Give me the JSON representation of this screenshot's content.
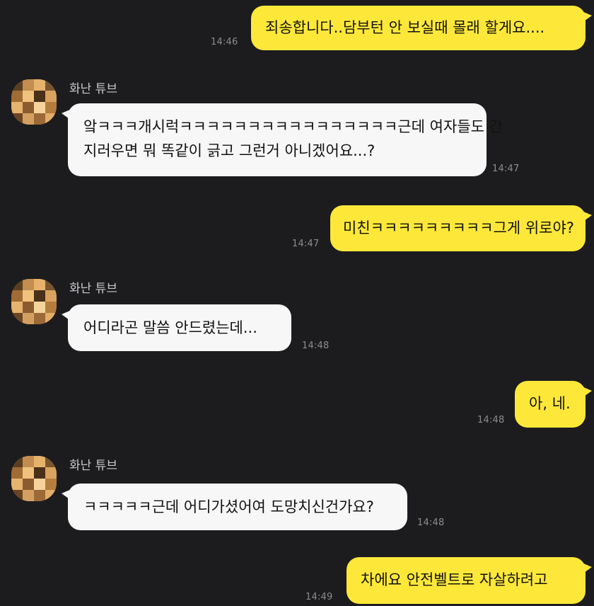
{
  "contact": {
    "name": "화난 튜브"
  },
  "messages": [
    {
      "side": "mine",
      "text": "죄송합니다..담부턴 안 보실때 몰래 할게요....",
      "time": "14:46"
    },
    {
      "side": "theirs",
      "line1": "앜ㅋㅋㅋ개시럭ㅋㅋㅋㅋㅋㅋㅋㅋㅋㅋㅋㅋㅋㅋㅋㅋ근데 여자들도 간",
      "line2": "지러우면 뭐 똑같이 긁고 그런거 아니겠어요...?",
      "time": "14:47"
    },
    {
      "side": "mine",
      "text": "미친ㅋㅋㅋㅋㅋㅋㅋㅋㅋ그게 위로야?",
      "time": "14:47"
    },
    {
      "side": "theirs",
      "text": "어디라곤 말씀 안드렸는데...",
      "time": "14:48"
    },
    {
      "side": "mine",
      "text": "아, 네.",
      "time": "14:48"
    },
    {
      "side": "theirs",
      "text": "ㅋㅋㅋㅋㅋ근데 어디가셨어여 도망치신건가요?",
      "time": "14:48"
    },
    {
      "side": "mine",
      "text": "차에요 안전벨트로 자살하려고",
      "time": "14:49"
    }
  ],
  "colors": {
    "background": "#1c1c1e",
    "my_bubble": "#fde83a",
    "their_bubble": "#f7f7f7",
    "time_text": "#8d8d8f"
  }
}
